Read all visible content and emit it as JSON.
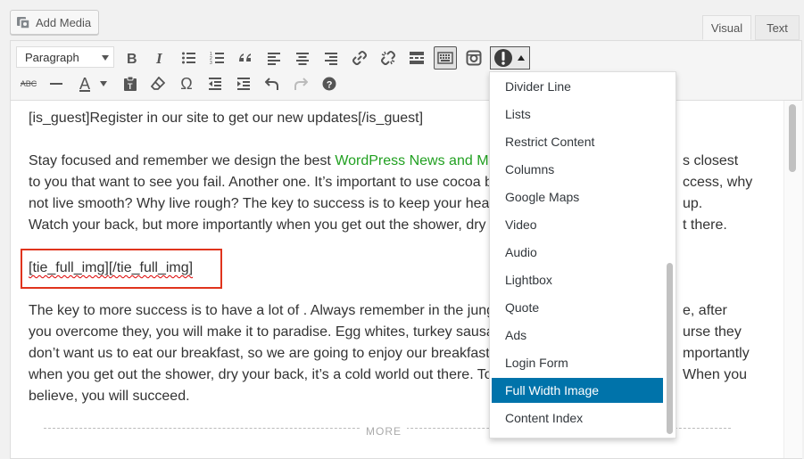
{
  "header": {
    "add_media_label": "Add Media",
    "tabs": [
      {
        "label": "Visual",
        "active": true
      },
      {
        "label": "Text",
        "active": false
      }
    ]
  },
  "toolbar": {
    "format_select_value": "Paragraph",
    "row1_icons": [
      "bold-icon",
      "italic-icon",
      "bullet-list-icon",
      "numbered-list-icon",
      "blockquote-icon",
      "align-left-icon",
      "align-center-icon",
      "align-right-icon",
      "link-icon",
      "unlink-icon",
      "read-more-icon",
      "toolbar-toggle-icon",
      "instagram-icon",
      "shortcodes-icon"
    ],
    "row2_icons": [
      "strikethrough-icon",
      "horizontal-line-icon",
      "text-color-icon",
      "paste-as-text-icon",
      "clear-formatting-icon",
      "special-character-icon",
      "outdent-icon",
      "indent-icon",
      "undo-icon",
      "redo-icon",
      "help-icon"
    ],
    "strikethrough_label": "ABC",
    "text_color_label": "A",
    "special_char_label": "Ω"
  },
  "content": {
    "para1": "[is_guest]Register in our site to get our new updates[/is_guest]",
    "para2_line1_pre": "Stay focused and remember we design the best ",
    "para2_line1_link": "WordPress News and Ma",
    "para2_line1_post": "s closest",
    "para2_line2_pre": "to you that want to see you fail. Another one. It’s important to use cocoa b",
    "para2_line2_post": "ccess, why",
    "para2_line3_pre": "not live smooth? Why live rough? The key to success is to keep your hea",
    "para2_line3_post": "up.",
    "para2_line4_pre": "Watch your back, but more importantly when you get out the shower, dry",
    "para2_line4_post": "t there.",
    "shortcode_open": "[tie_full_img]",
    "shortcode_close": "[/tie_full_img]",
    "para3_line1_pre": "The key to more success is to have a lot of . Always remember in the jung",
    "para3_line1_post": "e, after",
    "para3_line2_pre": "you overcome they, you will make it to paradise. Egg whites, turkey sausa",
    "para3_line2_post": "urse they",
    "para3_line3_pre": "don’t want us to eat our breakfast, so we are going to enjoy our breakfast",
    "para3_line3_post": "mportantly",
    "para3_line4_pre": "when you get out the shower, dry your back, it’s a cold world out there. To",
    "para3_line4_post": "When you",
    "para3_line5": "believe, you will succeed.",
    "more_label": "MORE"
  },
  "dropdown": {
    "items": [
      {
        "label": "Divider Line",
        "selected": false
      },
      {
        "label": "Lists",
        "selected": false
      },
      {
        "label": "Restrict Content",
        "selected": false
      },
      {
        "label": "Columns",
        "selected": false
      },
      {
        "label": "Google Maps",
        "selected": false
      },
      {
        "label": "Video",
        "selected": false
      },
      {
        "label": "Audio",
        "selected": false
      },
      {
        "label": "Lightbox",
        "selected": false
      },
      {
        "label": "Quote",
        "selected": false
      },
      {
        "label": "Ads",
        "selected": false
      },
      {
        "label": "Login Form",
        "selected": false
      },
      {
        "label": "Full Width Image",
        "selected": true
      },
      {
        "label": "Content Index",
        "selected": false
      }
    ]
  },
  "colors": {
    "link": "#21a021",
    "highlight_border": "#e0341d",
    "selected_item": "#0073aa"
  }
}
